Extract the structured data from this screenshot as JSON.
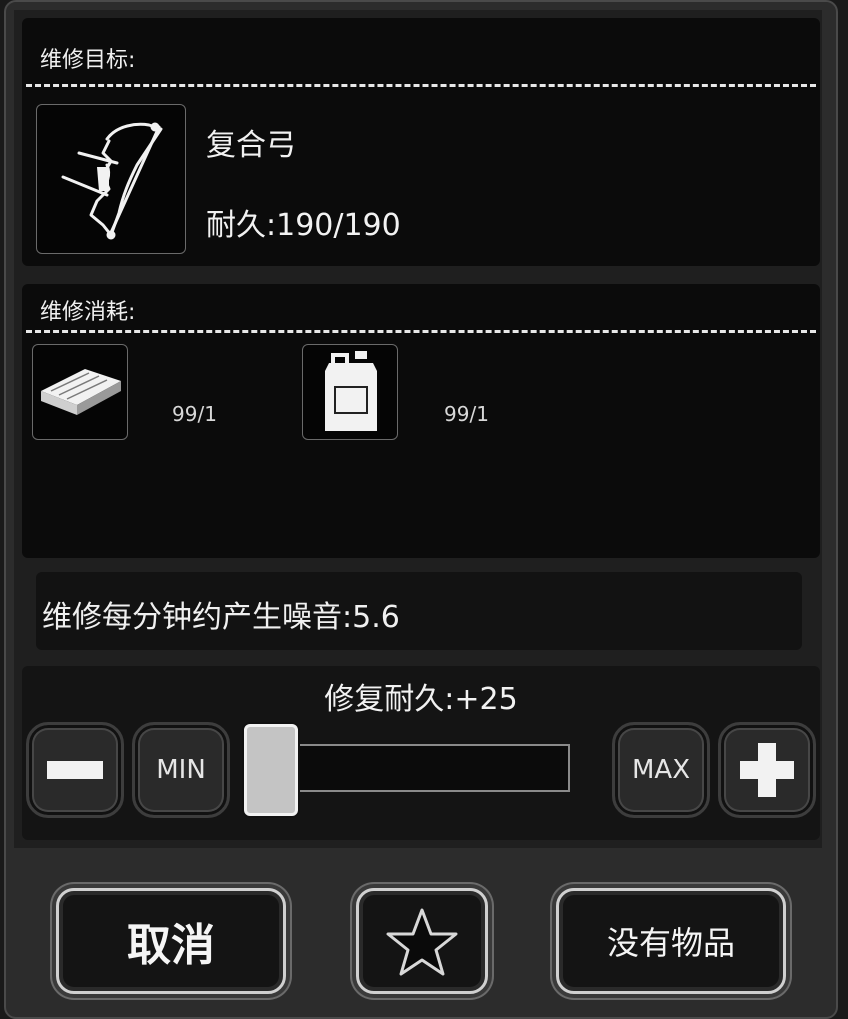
{
  "target": {
    "title": "维修目标:",
    "item_name": "复合弓",
    "durability": "耐久:190/190",
    "icon": "compound-bow-icon"
  },
  "consumables": {
    "title": "维修消耗:",
    "items": [
      {
        "icon": "metal-plate-icon",
        "count": "99/1"
      },
      {
        "icon": "oil-jug-icon",
        "count": "99/1"
      }
    ]
  },
  "noise": {
    "text": "维修每分钟约产生噪音:5.6"
  },
  "repair": {
    "label": "修复耐久:+25",
    "min_label": "MIN",
    "max_label": "MAX",
    "slider_fraction": 0.0
  },
  "buttons": {
    "cancel": "取消",
    "favorite_icon": "star-icon",
    "no_item": "没有物品"
  }
}
